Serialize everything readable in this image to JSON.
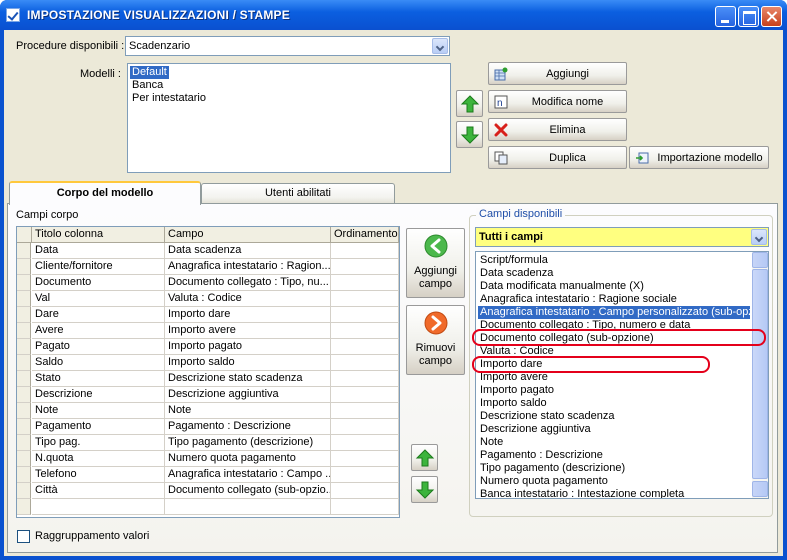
{
  "window": {
    "title": "IMPOSTAZIONE VISUALIZZAZIONI / STAMPE"
  },
  "procedure": {
    "label": "Procedure disponibili :",
    "value": "Scadenzario"
  },
  "modelli": {
    "label": "Modelli :",
    "items": [
      "Default",
      "Banca",
      "Per intestatario"
    ],
    "selected": "Default"
  },
  "buttons": {
    "aggiungi": "Aggiungi",
    "modifica_nome": "Modifica nome",
    "elimina": "Elimina",
    "duplica": "Duplica",
    "importazione": "Importazione modello",
    "aggiungi_campo": "Aggiungi\ncampo",
    "rimuovi_campo": "Rimuovi\ncampo"
  },
  "tabs": [
    {
      "label": "Corpo del modello",
      "active": true
    },
    {
      "label": "Utenti abilitati",
      "active": false
    }
  ],
  "campi_corpo": {
    "label": "Campi corpo",
    "columns": [
      "Titolo colonna",
      "Campo",
      "Ordinamento"
    ],
    "rows": [
      [
        "Data",
        "Data scadenza",
        ""
      ],
      [
        "Cliente/fornitore",
        "Anagrafica intestatario : Ragion...",
        ""
      ],
      [
        "Documento",
        "Documento collegato : Tipo, nu...",
        ""
      ],
      [
        "Val",
        "Valuta : Codice",
        ""
      ],
      [
        "Dare",
        "Importo dare",
        ""
      ],
      [
        "Avere",
        "Importo avere",
        ""
      ],
      [
        "Pagato",
        "Importo pagato",
        ""
      ],
      [
        "Saldo",
        "Importo saldo",
        ""
      ],
      [
        "Stato",
        "Descrizione stato scadenza",
        ""
      ],
      [
        "Descrizione",
        "Descrizione aggiuntiva",
        ""
      ],
      [
        "Note",
        "Note",
        ""
      ],
      [
        "Pagamento",
        "Pagamento : Descrizione",
        ""
      ],
      [
        "Tipo pag.",
        "Tipo pagamento (descrizione)",
        ""
      ],
      [
        "N.quota",
        "Numero quota pagamento",
        ""
      ],
      [
        "Telefono",
        "Anagrafica intestatario : Campo ...",
        ""
      ],
      [
        "Città",
        "Documento collegato (sub-opzio...",
        ""
      ]
    ]
  },
  "campi_disponibili": {
    "label": "Campi disponibili",
    "filter": "Tutti i campi",
    "items": [
      "Script/formula",
      "Data scadenza",
      "Data modificata manualmente (X)",
      "Anagrafica intestatario : Ragione sociale",
      "Anagrafica intestatario : Campo personalizzato (sub-opzione)",
      "Documento collegato : Tipo, numero e data",
      "Documento collegato (sub-opzione)",
      "Valuta : Codice",
      "Importo dare",
      "Importo avere",
      "Importo pagato",
      "Importo saldo",
      "Descrizione stato scadenza",
      "Descrizione aggiuntiva",
      "Note",
      "Pagamento : Descrizione",
      "Tipo pagamento (descrizione)",
      "Numero quota pagamento",
      "Banca intestatario : Intestazione completa"
    ],
    "selected": "Anagrafica intestatario : Campo personalizzato (sub-opzione)",
    "highlighted": [
      "Anagrafica intestatario : Campo personalizzato (sub-opzione)",
      "Documento collegato (sub-opzione)"
    ]
  },
  "raggruppamento": {
    "label": "Raggruppamento valori",
    "checked": false
  },
  "colors": {
    "accent": "#316ac5",
    "highlight_oval": "#e4001b",
    "filter_bg": "#ffff80"
  }
}
